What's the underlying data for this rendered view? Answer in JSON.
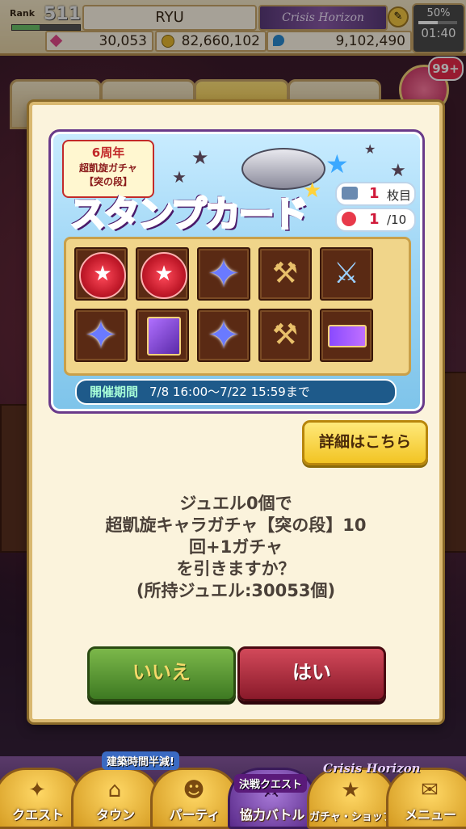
{
  "header": {
    "rank_label": "Rank",
    "rank_value": "511",
    "rank_progress": 0.4,
    "player_name": "RYU",
    "guild_title": "Crisis Horizon",
    "jewels": "30,053",
    "coins": "82,660,102",
    "potions": "9,102,490",
    "battery": "50%",
    "battery_level": 0.5,
    "clock": "01:40"
  },
  "background": {
    "gift_badge": "99+"
  },
  "modal": {
    "banner": {
      "anniversary_line1": "6周年",
      "anniversary_line2": "超凱旋ガチャ",
      "anniversary_line3": "【突の段】",
      "title_part1": "スタンプ",
      "title_part2": "カード",
      "card_count": "1",
      "card_suffix": "枚目",
      "stamp_count": "1",
      "stamp_total": "/10",
      "period_label": "開催期間",
      "period_value": "7/8  16:00〜7/22  15:59まで",
      "cells": [
        "stamp-seal-icon",
        "stamp-seal-icon",
        "star-crystal-icon",
        "golden-hammer-icon",
        "blue-sword-icon",
        "star-crystal-icon",
        "purple-book-icon",
        "star-crystal-icon",
        "golden-hammer-icon",
        "ticket-icon"
      ]
    },
    "detail_button": "詳細はこちら",
    "message_lines": [
      "ジュエル0個で",
      "超凱旋キャラガチャ【突の段】10",
      "回+1ガチャ",
      "を引きますか？",
      "(所持ジュエル:30053個)"
    ],
    "no_button": "いいえ",
    "yes_button": "はい"
  },
  "bottom_nav": {
    "items": [
      {
        "label": "クエスト",
        "icon": "quest-map-icon"
      },
      {
        "label": "タウン",
        "icon": "town-icon"
      },
      {
        "label": "パーティ",
        "icon": "party-icon"
      },
      {
        "label": "協力バトル",
        "icon": "coop-battle-icon"
      },
      {
        "label": "ガチャ・ショップ",
        "icon": "gacha-shop-icon"
      },
      {
        "label": "メニュー",
        "icon": "menu-icon"
      }
    ],
    "promo_town": "建築時間半減!",
    "promo_coop": "決戦クエスト",
    "promo_gacha": "Crisis Horizon"
  },
  "colors": {
    "accent_gold": "#d9b870",
    "yes_red": "#8a1a2a",
    "no_green": "#3e7a22"
  }
}
